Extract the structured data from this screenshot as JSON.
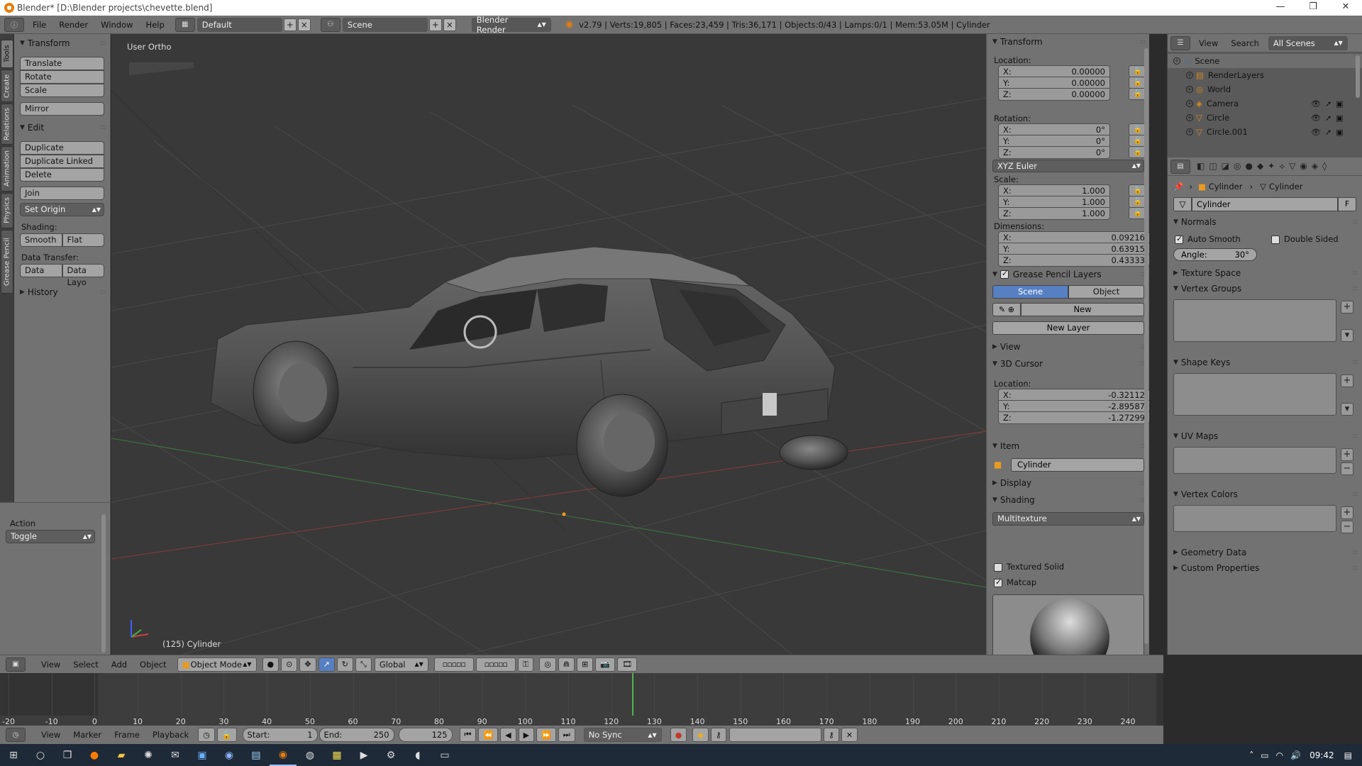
{
  "window": {
    "title": "Blender* [D:\\Blender projects\\chevette.blend]",
    "controls": [
      "—",
      "❐",
      "✕"
    ]
  },
  "infobar": {
    "menus": [
      "File",
      "Render",
      "Window",
      "Help"
    ],
    "layout": "Default",
    "scene": "Scene",
    "engine": "Blender Render",
    "stats": "v2.79 | Verts:19,805 | Faces:23,459 | Tris:36,171 | Objects:0/43 | Lamps:0/1 | Mem:53.05M | Cylinder"
  },
  "lefttabs": [
    "Tools",
    "Create",
    "Relations",
    "Animation",
    "Physics",
    "Grease Pencil"
  ],
  "toolshelf": {
    "transform_header": "Transform",
    "transform_buttons": [
      "Translate",
      "Rotate",
      "Scale"
    ],
    "mirror": "Mirror",
    "edit_header": "Edit",
    "edit_buttons": [
      "Duplicate",
      "Duplicate Linked",
      "Delete"
    ],
    "join": "Join",
    "set_origin": "Set Origin",
    "shading_label": "Shading:",
    "smooth": "Smooth",
    "flat": "Flat",
    "data_transfer_label": "Data Transfer:",
    "data": "Data",
    "data_layout": "Data Layo",
    "history_header": "History"
  },
  "action_panel": {
    "label": "Action",
    "value": "Toggle"
  },
  "viewport": {
    "view_label": "User Ortho",
    "object_label": "(125) Cylinder"
  },
  "npanel": {
    "transform_header": "Transform",
    "location_label": "Location:",
    "location": [
      {
        "axis": "X:",
        "value": "0.00000"
      },
      {
        "axis": "Y:",
        "value": "0.00000"
      },
      {
        "axis": "Z:",
        "value": "0.00000"
      }
    ],
    "rotation_label": "Rotation:",
    "rotation": [
      {
        "axis": "X:",
        "value": "0°"
      },
      {
        "axis": "Y:",
        "value": "0°"
      },
      {
        "axis": "Z:",
        "value": "0°"
      }
    ],
    "rotation_mode": "XYZ Euler",
    "scale_label": "Scale:",
    "scale": [
      {
        "axis": "X:",
        "value": "1.000"
      },
      {
        "axis": "Y:",
        "value": "1.000"
      },
      {
        "axis": "Z:",
        "value": "1.000"
      }
    ],
    "dimensions_label": "Dimensions:",
    "dimensions": [
      {
        "axis": "X:",
        "value": "0.09216"
      },
      {
        "axis": "Y:",
        "value": "0.63915"
      },
      {
        "axis": "Z:",
        "value": "0.43333"
      }
    ],
    "gp_layers_header": "Grease Pencil Layers",
    "gp_scene": "Scene",
    "gp_object": "Object",
    "gp_new": "New",
    "gp_new_layer": "New Layer",
    "view_header": "View",
    "cursor_header": "3D Cursor",
    "cursor_location_label": "Location:",
    "cursor": [
      {
        "axis": "X:",
        "value": "-0.32112"
      },
      {
        "axis": "Y:",
        "value": "-2.89587"
      },
      {
        "axis": "Z:",
        "value": "-1.27299"
      }
    ],
    "item_header": "Item",
    "item_name": "Cylinder",
    "display_header": "Display",
    "shading_header": "Shading",
    "shading_mode": "Multitexture",
    "textured_solid": "Textured Solid",
    "matcap": "Matcap"
  },
  "outliner": {
    "view": "View",
    "search": "Search",
    "filter": "All Scenes",
    "items": [
      {
        "name": "Scene",
        "depth": 0
      },
      {
        "name": "RenderLayers",
        "depth": 1
      },
      {
        "name": "World",
        "depth": 1
      },
      {
        "name": "Camera",
        "depth": 1
      },
      {
        "name": "Circle",
        "depth": 1
      },
      {
        "name": "Circle.001",
        "depth": 1
      }
    ]
  },
  "properties": {
    "breadcrumb_object": "Cylinder",
    "breadcrumb_data": "Cylinder",
    "mesh_name": "Cylinder",
    "fake_user": "F",
    "normals_header": "Normals",
    "auto_smooth": "Auto Smooth",
    "double_sided": "Double Sided",
    "angle_label": "Angle:",
    "angle_value": "30°",
    "texture_space": "Texture Space",
    "vertex_groups": "Vertex Groups",
    "shape_keys": "Shape Keys",
    "uv_maps": "UV Maps",
    "vertex_colors": "Vertex Colors",
    "geometry_data": "Geometry Data",
    "custom_properties": "Custom Properties"
  },
  "vpheader": {
    "menus": [
      "View",
      "Select",
      "Add",
      "Object"
    ],
    "mode": "Object Mode",
    "orientation": "Global"
  },
  "timeline": {
    "numbers": [
      "-20",
      "-10",
      "0",
      "10",
      "20",
      "30",
      "40",
      "50",
      "60",
      "70",
      "80",
      "90",
      "100",
      "110",
      "120",
      "130",
      "140",
      "150",
      "160",
      "170",
      "180",
      "190",
      "200",
      "210",
      "220",
      "230",
      "240"
    ],
    "current_frame": 125,
    "range_min": -20,
    "range_max": 240
  },
  "tlheader": {
    "menus": [
      "View",
      "Marker",
      "Frame",
      "Playback"
    ],
    "start_label": "Start:",
    "start_value": "1",
    "end_label": "End:",
    "end_value": "250",
    "current": "125",
    "sync": "No Sync"
  },
  "taskbar": {
    "time": "09:42"
  }
}
